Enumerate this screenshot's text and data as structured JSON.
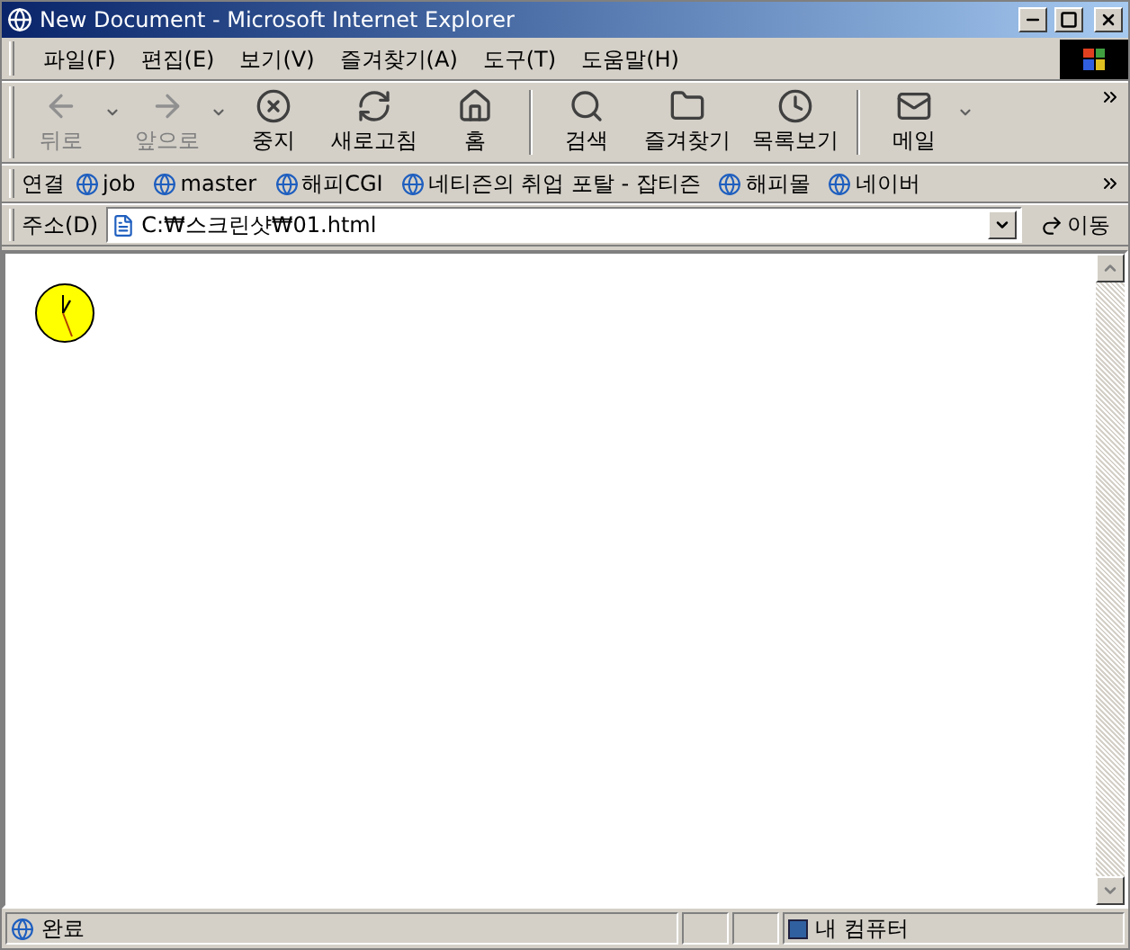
{
  "window": {
    "title": "New Document - Microsoft Internet Explorer"
  },
  "menu": [
    "파일(F)",
    "편집(E)",
    "보기(V)",
    "즐겨찾기(A)",
    "도구(T)",
    "도움말(H)"
  ],
  "toolbar": [
    [
      {
        "kind": "back",
        "label": "뒤로",
        "disabled": true,
        "dropdown": true
      },
      {
        "kind": "forward",
        "label": "앞으로",
        "disabled": true,
        "dropdown": true
      },
      {
        "kind": "stop",
        "label": "중지",
        "disabled": false,
        "dropdown": false
      },
      {
        "kind": "refresh",
        "label": "새로고침",
        "disabled": false,
        "dropdown": false
      },
      {
        "kind": "home",
        "label": "홈",
        "disabled": false,
        "dropdown": false
      }
    ],
    [
      {
        "kind": "search",
        "label": "검색",
        "disabled": false,
        "dropdown": false
      },
      {
        "kind": "favorites",
        "label": "즐겨찾기",
        "disabled": false,
        "dropdown": false
      },
      {
        "kind": "history",
        "label": "목록보기",
        "disabled": false,
        "dropdown": false
      }
    ],
    [
      {
        "kind": "mail",
        "label": "메일",
        "disabled": false,
        "dropdown": true
      }
    ]
  ],
  "links": {
    "label": "연결",
    "items": [
      "job",
      "master",
      "해피CGI",
      "네티즌의 취업 포탈 - 잡티즌",
      "해피몰",
      "네이버"
    ]
  },
  "address": {
    "label": "주소(D)",
    "value": "C:₩스크린샷₩01.html",
    "go": "이동"
  },
  "status_bar": {
    "text": "완료",
    "zone": "내 컴퓨터"
  }
}
